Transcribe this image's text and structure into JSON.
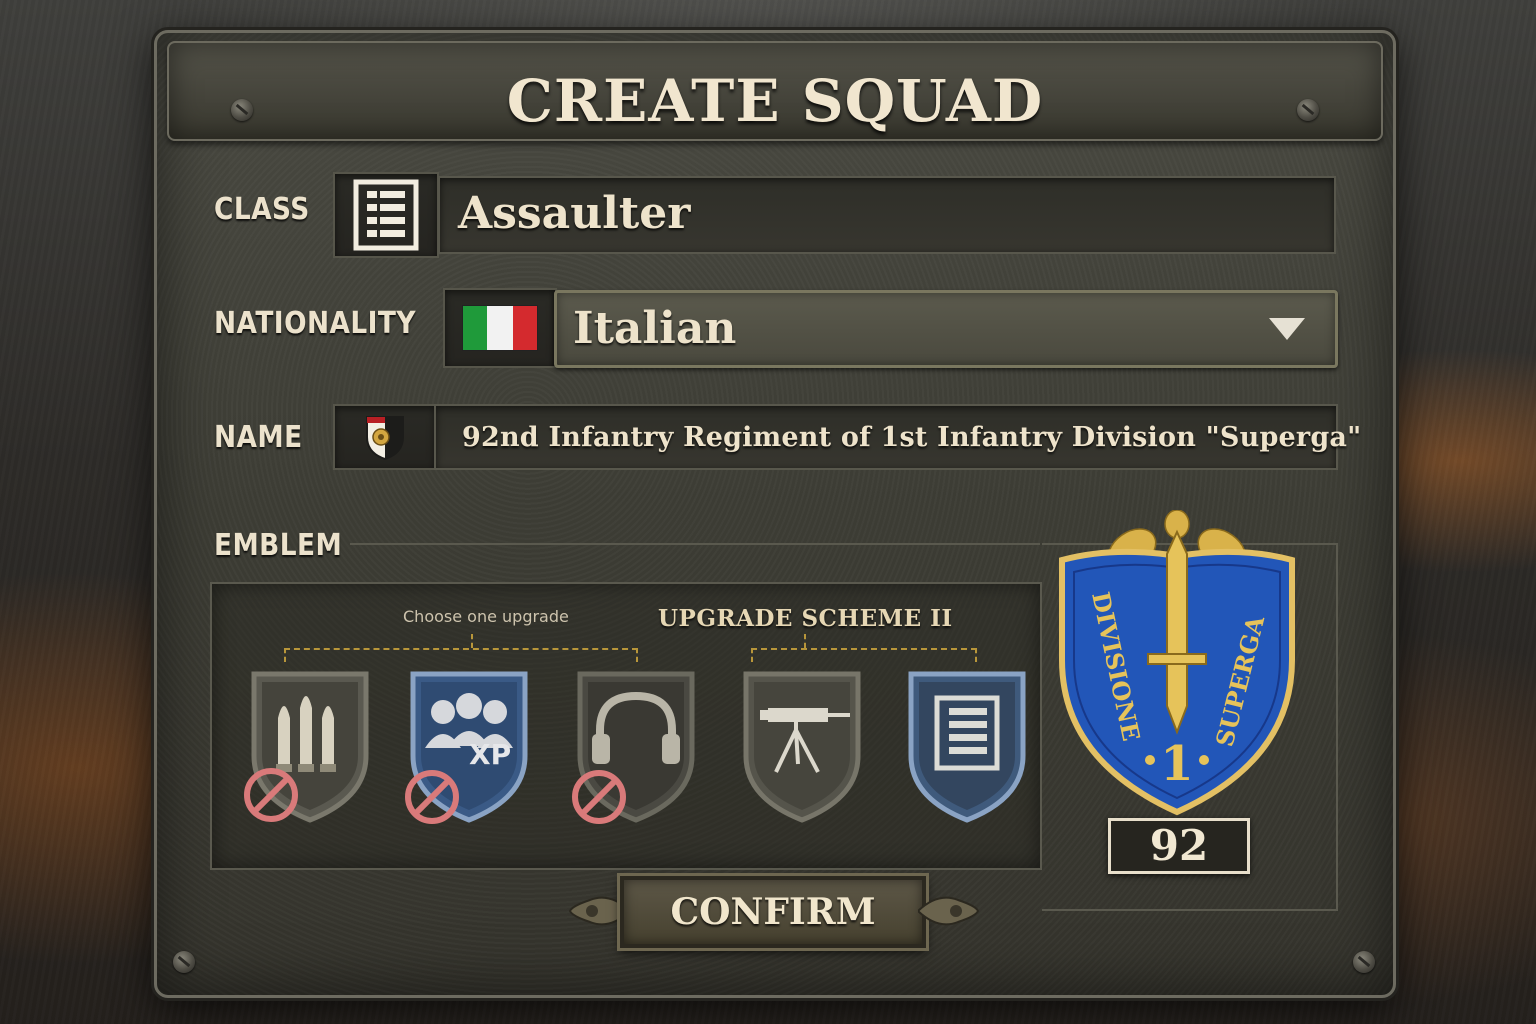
{
  "dialog": {
    "title": "CREATE SQUAD"
  },
  "class": {
    "label": "CLASS",
    "value": "Assaulter",
    "icon": "assaulter-class-icon"
  },
  "nationality": {
    "label": "NATIONALITY",
    "value": "Italian",
    "flag_icon": "italian-flag-icon",
    "flag_colors": [
      "#1f9a3a",
      "#f2f2f2",
      "#d42a2e"
    ]
  },
  "name": {
    "label": "NAME",
    "value": "92nd Infantry Regiment of 1st Infantry Division \"Superga\"",
    "icon": "regiment-crest-icon"
  },
  "emblem": {
    "label": "EMBLEM",
    "hint": "Choose one upgrade",
    "scheme_title": "UPGRADE SCHEME II",
    "upgrades": [
      {
        "icon": "ammo-icon",
        "locked": true
      },
      {
        "icon": "squad-xp-icon",
        "locked": true,
        "badge": "XP"
      },
      {
        "icon": "headset-icon",
        "locked": true
      },
      {
        "icon": "machine-gun-icon",
        "locked": false
      },
      {
        "icon": "assaulter-class-icon",
        "locked": false
      }
    ],
    "division_emblem": {
      "left_text": "DIVISIONE",
      "right_text": "SUPERGA",
      "center_number": "1",
      "colors": {
        "field": "#2256b8",
        "gold": "#d9b24a",
        "border": "#e3c064"
      }
    },
    "regiment_number": "92"
  },
  "actions": {
    "confirm_label": "CONFIRM"
  }
}
